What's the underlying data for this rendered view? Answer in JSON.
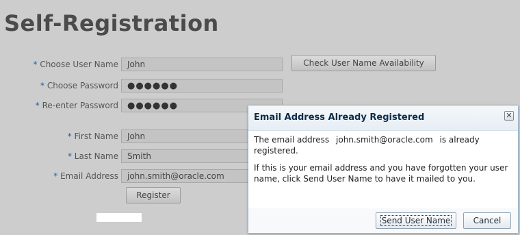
{
  "page": {
    "title": "Self-Registration"
  },
  "form": {
    "required_marker": "*",
    "username": {
      "label": "Choose User Name",
      "value": "John"
    },
    "password": {
      "label": "Choose Password",
      "value": "●●●●●●"
    },
    "password_confirm": {
      "label": "Re-enter Password",
      "value": "●●●●●●"
    },
    "first_name": {
      "label": "First Name",
      "value": "John"
    },
    "last_name": {
      "label": "Last Name",
      "value": "Smith"
    },
    "email": {
      "label": "Email Address",
      "value": "john.smith@oracle.com"
    },
    "check_availability_label": "Check User Name Availability",
    "register_label": "Register"
  },
  "dialog": {
    "title": "Email Address Already Registered",
    "close_glyph": "✕",
    "message1_prefix": "The email address",
    "message1_email": "john.smith@oracle.com",
    "message1_suffix": "is already registered.",
    "message2": "If this is your email address and you have forgotten your user name, click Send User Name to have it mailed to you.",
    "send_label": "Send User Name",
    "cancel_label": "Cancel"
  }
}
